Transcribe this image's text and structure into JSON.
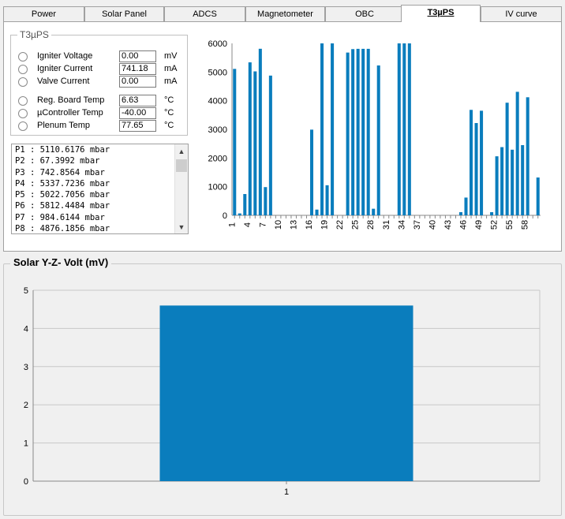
{
  "tabs": [
    {
      "label": "Power",
      "active": false
    },
    {
      "label": "Solar Panel",
      "active": false
    },
    {
      "label": "ADCS",
      "active": false
    },
    {
      "label": "Magnetometer",
      "active": false
    },
    {
      "label": "OBC",
      "active": false
    },
    {
      "label": "T3µPS",
      "active": true
    },
    {
      "label": "IV curve",
      "active": false
    }
  ],
  "group": {
    "title": "T3µPS",
    "rows": [
      {
        "label": "Igniter Voltage",
        "value": "0.00",
        "unit": "mV"
      },
      {
        "label": "Igniter Current",
        "value": "741.18",
        "unit": "mA"
      },
      {
        "label": "Valve Current",
        "value": "0.00",
        "unit": "mA"
      },
      {
        "label": "Reg. Board Temp",
        "value": "6.63",
        "unit": "°C"
      },
      {
        "label": "µController Temp",
        "value": "-40.00",
        "unit": "°C"
      },
      {
        "label": "Plenum Temp",
        "value": "77.65",
        "unit": "°C"
      }
    ]
  },
  "log": {
    "lines": [
      "P1 : 5110.6176 mbar",
      "P2 : 67.3992 mbar",
      "P3 : 742.8564 mbar",
      "P4 : 5337.7236 mbar",
      "P5 : 5022.7056 mbar",
      "P6 : 5812.4484 mbar",
      "P7 : 984.6144 mbar",
      "P8 : 4876.1856 mbar"
    ],
    "scroll_up": "▲",
    "scroll_down": "▼"
  },
  "colors": {
    "bar": "#0a7dbd",
    "grid": "#c8c8c8"
  },
  "lower_panel": {
    "title": "Solar  Y-Z- Volt (mV)"
  },
  "chart_data": [
    {
      "type": "bar",
      "ylim": [
        0,
        6000
      ],
      "yticks": [
        0,
        1000,
        2000,
        3000,
        4000,
        5000,
        6000
      ],
      "xtick_labels": [
        "1",
        "4",
        "7",
        "10",
        "13",
        "16",
        "19",
        "22",
        "25",
        "28",
        "31",
        "34",
        "37",
        "40",
        "43",
        "46",
        "49",
        "52",
        "55",
        "58"
      ],
      "values": [
        5110,
        67,
        743,
        5338,
        5023,
        5812,
        985,
        4876,
        0,
        0,
        0,
        0,
        0,
        0,
        0,
        2990,
        200,
        6000,
        1050,
        6000,
        0,
        0,
        5680,
        5800,
        5810,
        5810,
        5810,
        230,
        5230,
        0,
        0,
        0,
        6000,
        6000,
        6000,
        0,
        0,
        0,
        0,
        0,
        0,
        0,
        0,
        0,
        110,
        620,
        3680,
        3220,
        3650,
        0,
        110,
        2060,
        2380,
        3930,
        2290,
        4310,
        2450,
        4120,
        0,
        1320
      ]
    },
    {
      "type": "bar",
      "categories": [
        "1"
      ],
      "values": [
        4.6
      ],
      "ylim": [
        0,
        5
      ],
      "yticks": [
        0,
        1,
        2,
        3,
        4,
        5
      ]
    }
  ]
}
